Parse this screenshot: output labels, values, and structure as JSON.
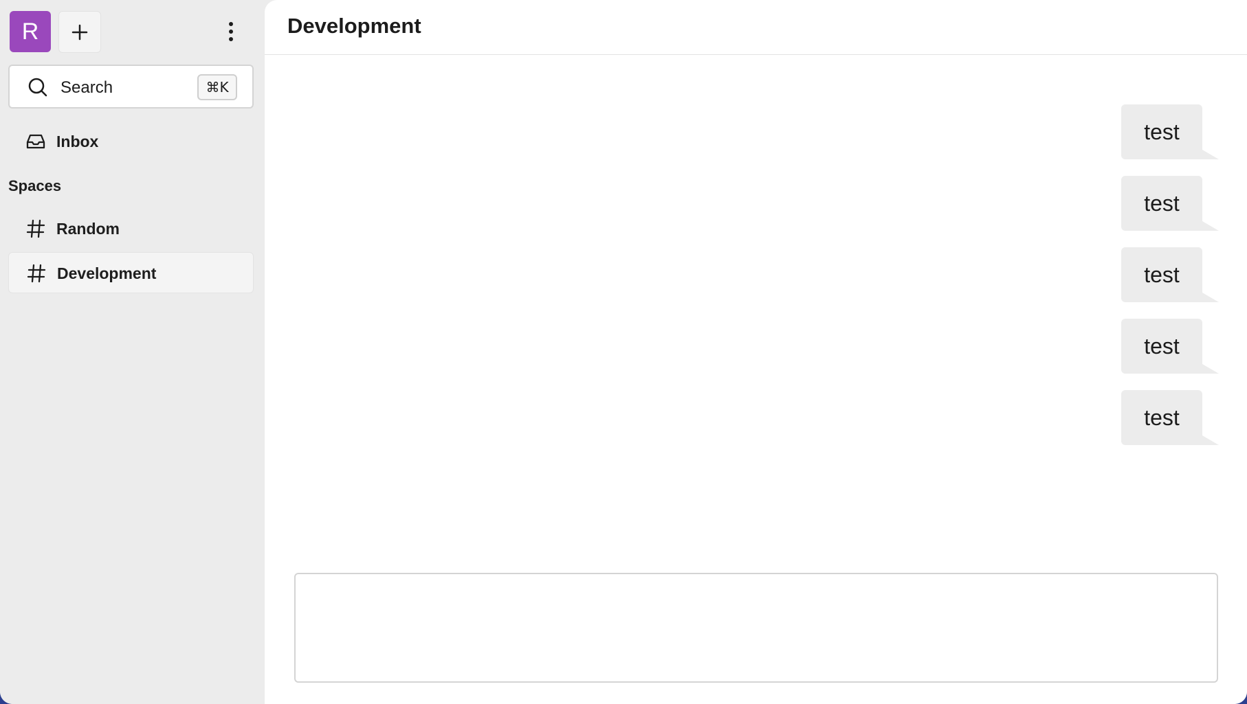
{
  "workspace": {
    "avatar_letter": "R",
    "avatar_color": "#9a48bc"
  },
  "sidebar": {
    "search": {
      "label": "Search",
      "shortcut": "⌘K"
    },
    "inbox_label": "Inbox",
    "spaces_heading": "Spaces",
    "spaces": [
      {
        "label": "Random",
        "active": false
      },
      {
        "label": "Development",
        "active": true
      }
    ]
  },
  "channel": {
    "title": "Development"
  },
  "messages": [
    {
      "text": "test"
    },
    {
      "text": "test"
    },
    {
      "text": "test"
    },
    {
      "text": "test"
    },
    {
      "text": "test"
    }
  ],
  "composer": {
    "value": ""
  },
  "colors": {
    "sidebar_bg": "#ececec",
    "main_bg": "#ffffff",
    "bubble_bg": "#ececec",
    "frame_bg": "#2c3f8f"
  }
}
